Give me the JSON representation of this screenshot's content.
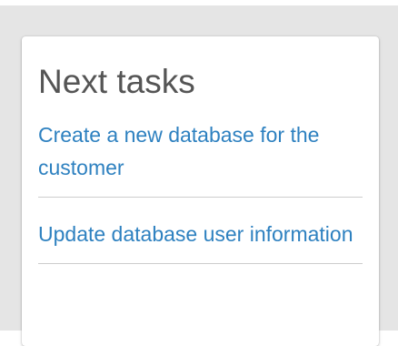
{
  "card": {
    "title": "Next tasks",
    "tasks": [
      {
        "label": "Create a new database for the customer"
      },
      {
        "label": "Update database user information"
      }
    ]
  },
  "colors": {
    "link": "#2e81c0",
    "title": "#555555",
    "divider": "#cccccc",
    "backdrop": "#e5e5e5"
  }
}
